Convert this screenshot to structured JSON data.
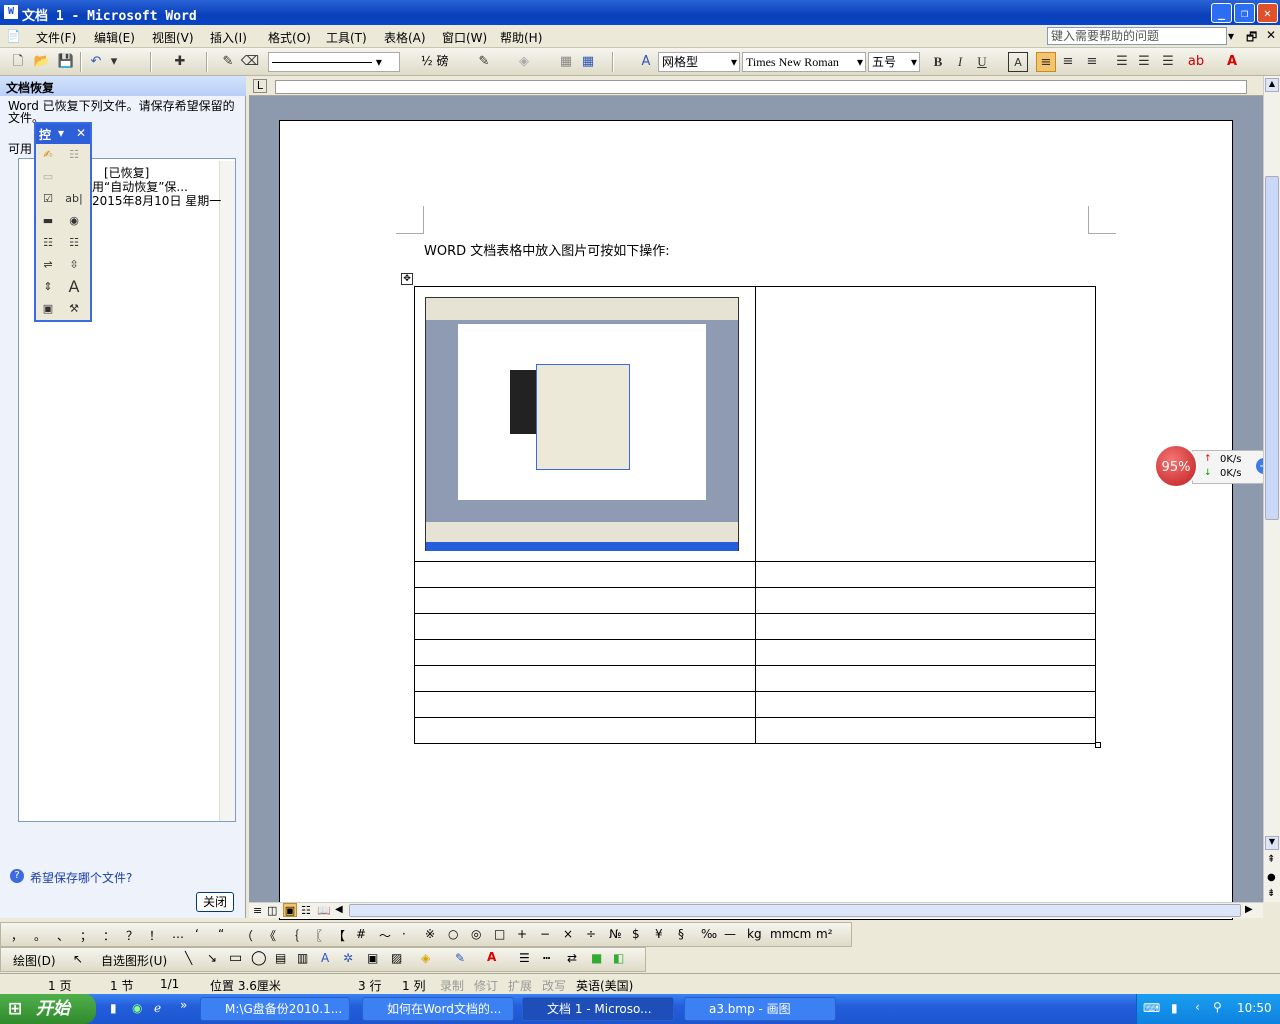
{
  "window": {
    "title": "文档 1 - Microsoft Word",
    "icon": "word-icon"
  },
  "menu": {
    "items": [
      "文件(F)",
      "编辑(E)",
      "视图(V)",
      "插入(I)",
      "格式(O)",
      "工具(T)",
      "表格(A)",
      "窗口(W)",
      "帮助(H)"
    ],
    "help_placeholder": "键入需要帮助的问题"
  },
  "toolbar": {
    "line_weight": "½ 磅",
    "table_style": "网格型",
    "font": "Times New Roman",
    "font_size": "五号",
    "bold": "B",
    "italic": "I",
    "underline": "U",
    "font_color_label": "A"
  },
  "task_pane": {
    "title": "文档恢复",
    "message": "Word 已恢复下列文件。请保存希望保留的文件。",
    "available_label": "可用",
    "file_name": "[已恢复]",
    "file_desc": "用“自动恢复”保...",
    "file_date": "2015年8月10日 星期一",
    "help_link": "希望保存哪个文件?",
    "close_button": "关闭"
  },
  "control_toolbox": {
    "title": "控"
  },
  "document": {
    "text": "WORD 文档表格中放入图片可按如下操作:",
    "table_rows": 8,
    "table_cols": 2
  },
  "net_widget": {
    "percent": "95%",
    "up": "0K/s",
    "down": "0K/s"
  },
  "symbols": [
    "，",
    "。",
    "、",
    "；",
    "：",
    "？",
    "！",
    "…",
    "‘",
    "“",
    "（",
    "《",
    "｛",
    "〖",
    "【",
    "#",
    "～",
    "·",
    "※",
    "○",
    "◎",
    "□",
    "+",
    "−",
    "×",
    "÷",
    "№",
    "$",
    "¥",
    "§",
    "‰",
    "—",
    "kg",
    "mm",
    "cm",
    "m²"
  ],
  "draw_bar": {
    "draw": "绘图(D)",
    "autoshape": "自选图形(U)"
  },
  "status": {
    "page": "1 页",
    "section": "1 节",
    "pages": "1/1",
    "position": "位置 3.6厘米",
    "line": "3 行",
    "col": "1 列",
    "rec": "录制",
    "trk": "修订",
    "ext": "扩展",
    "ovr": "改写",
    "lang": "英语(美国)"
  },
  "taskbar": {
    "start": "开始",
    "tasks": [
      "M:\\G盘备份2010.1...",
      "如何在Word文档的...",
      "文档 1 - Microso...",
      "a3.bmp - 画图"
    ],
    "time": "10:50"
  }
}
